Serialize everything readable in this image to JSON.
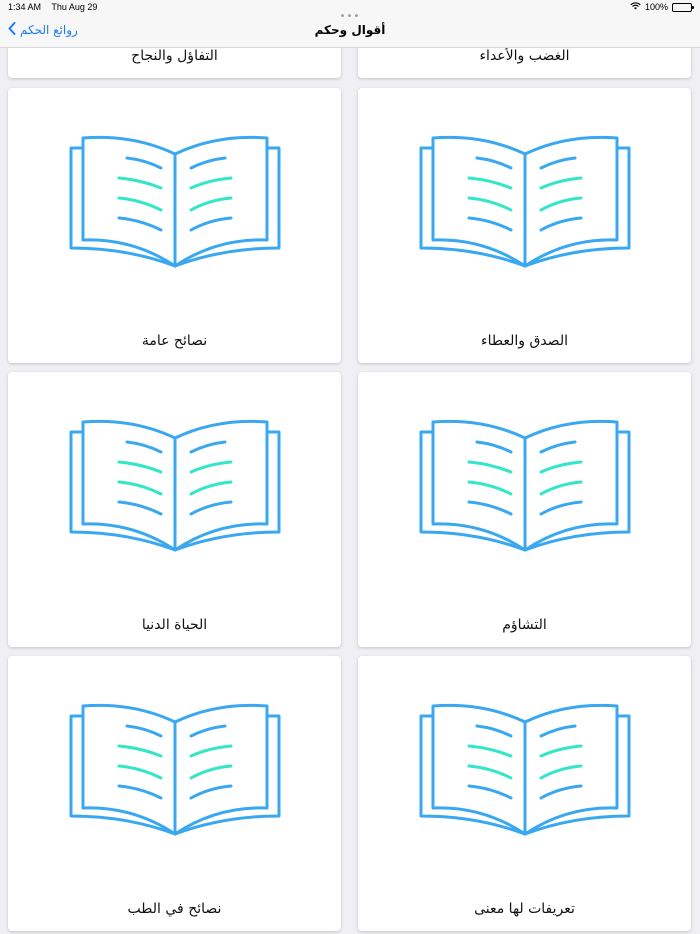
{
  "status_bar": {
    "time": "1:34 AM",
    "date": "Thu Aug 29",
    "battery": "100%"
  },
  "nav": {
    "back_label": "روائع الحكم",
    "title": "أقوال وحكم"
  },
  "grid": {
    "partial_row": [
      {
        "label": "الغضب والأعداء"
      },
      {
        "label": "التفاؤل والنجاح"
      }
    ],
    "items": [
      {
        "label": "الصدق والعطاء"
      },
      {
        "label": "نصائح عامة"
      },
      {
        "label": "التشاؤم"
      },
      {
        "label": "الحياة الدنيا"
      },
      {
        "label": "تعريفات لها معنى"
      },
      {
        "label": "نصائح في الطب"
      }
    ]
  },
  "colors": {
    "book_stroke": "#3aa8f0",
    "book_accent": "#32e6c8",
    "tint": "#1a7cf5"
  }
}
